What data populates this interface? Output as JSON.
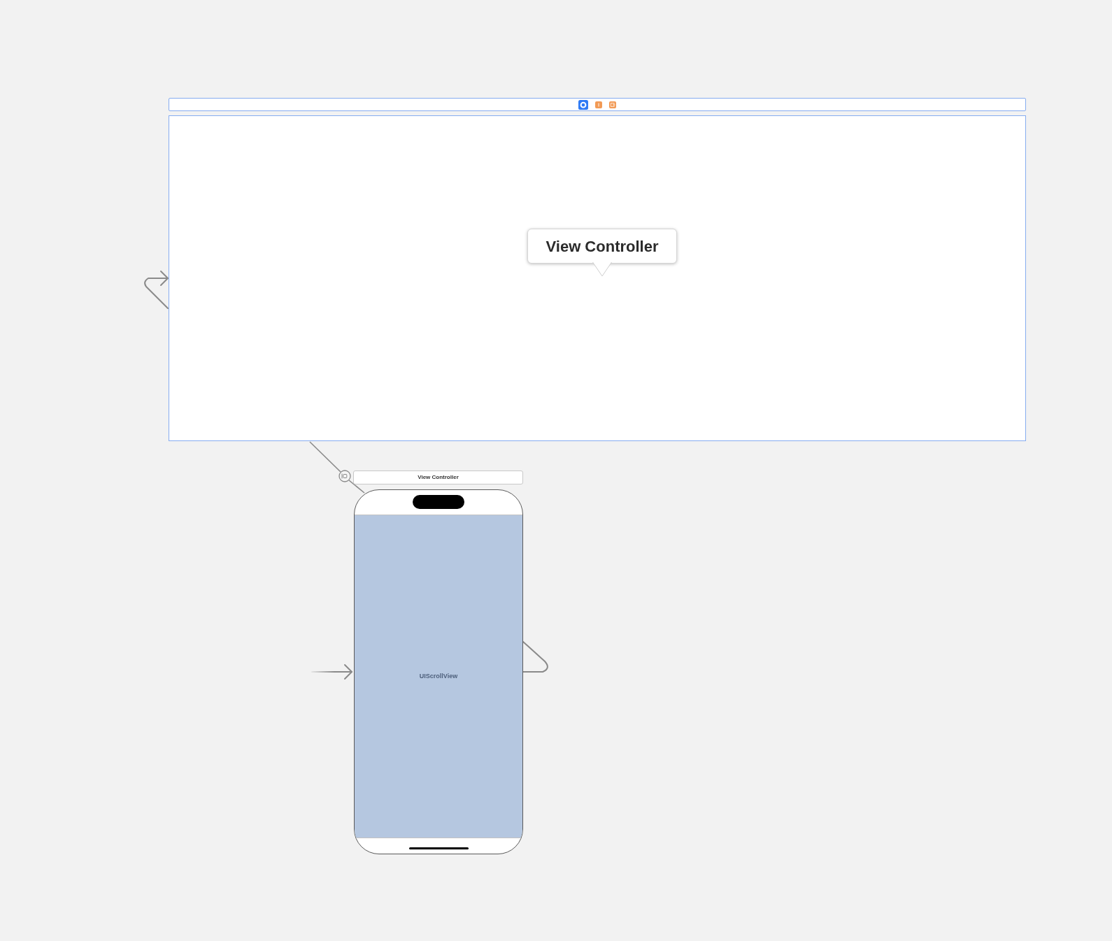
{
  "large_scene": {
    "selected": true,
    "dock_icons": [
      {
        "kind": "view-controller"
      },
      {
        "kind": "first-responder"
      },
      {
        "kind": "exit"
      }
    ],
    "tooltip": "View Controller"
  },
  "phone_scene": {
    "selected": false,
    "title": "View Controller",
    "screen_label": "UIScrollView"
  }
}
